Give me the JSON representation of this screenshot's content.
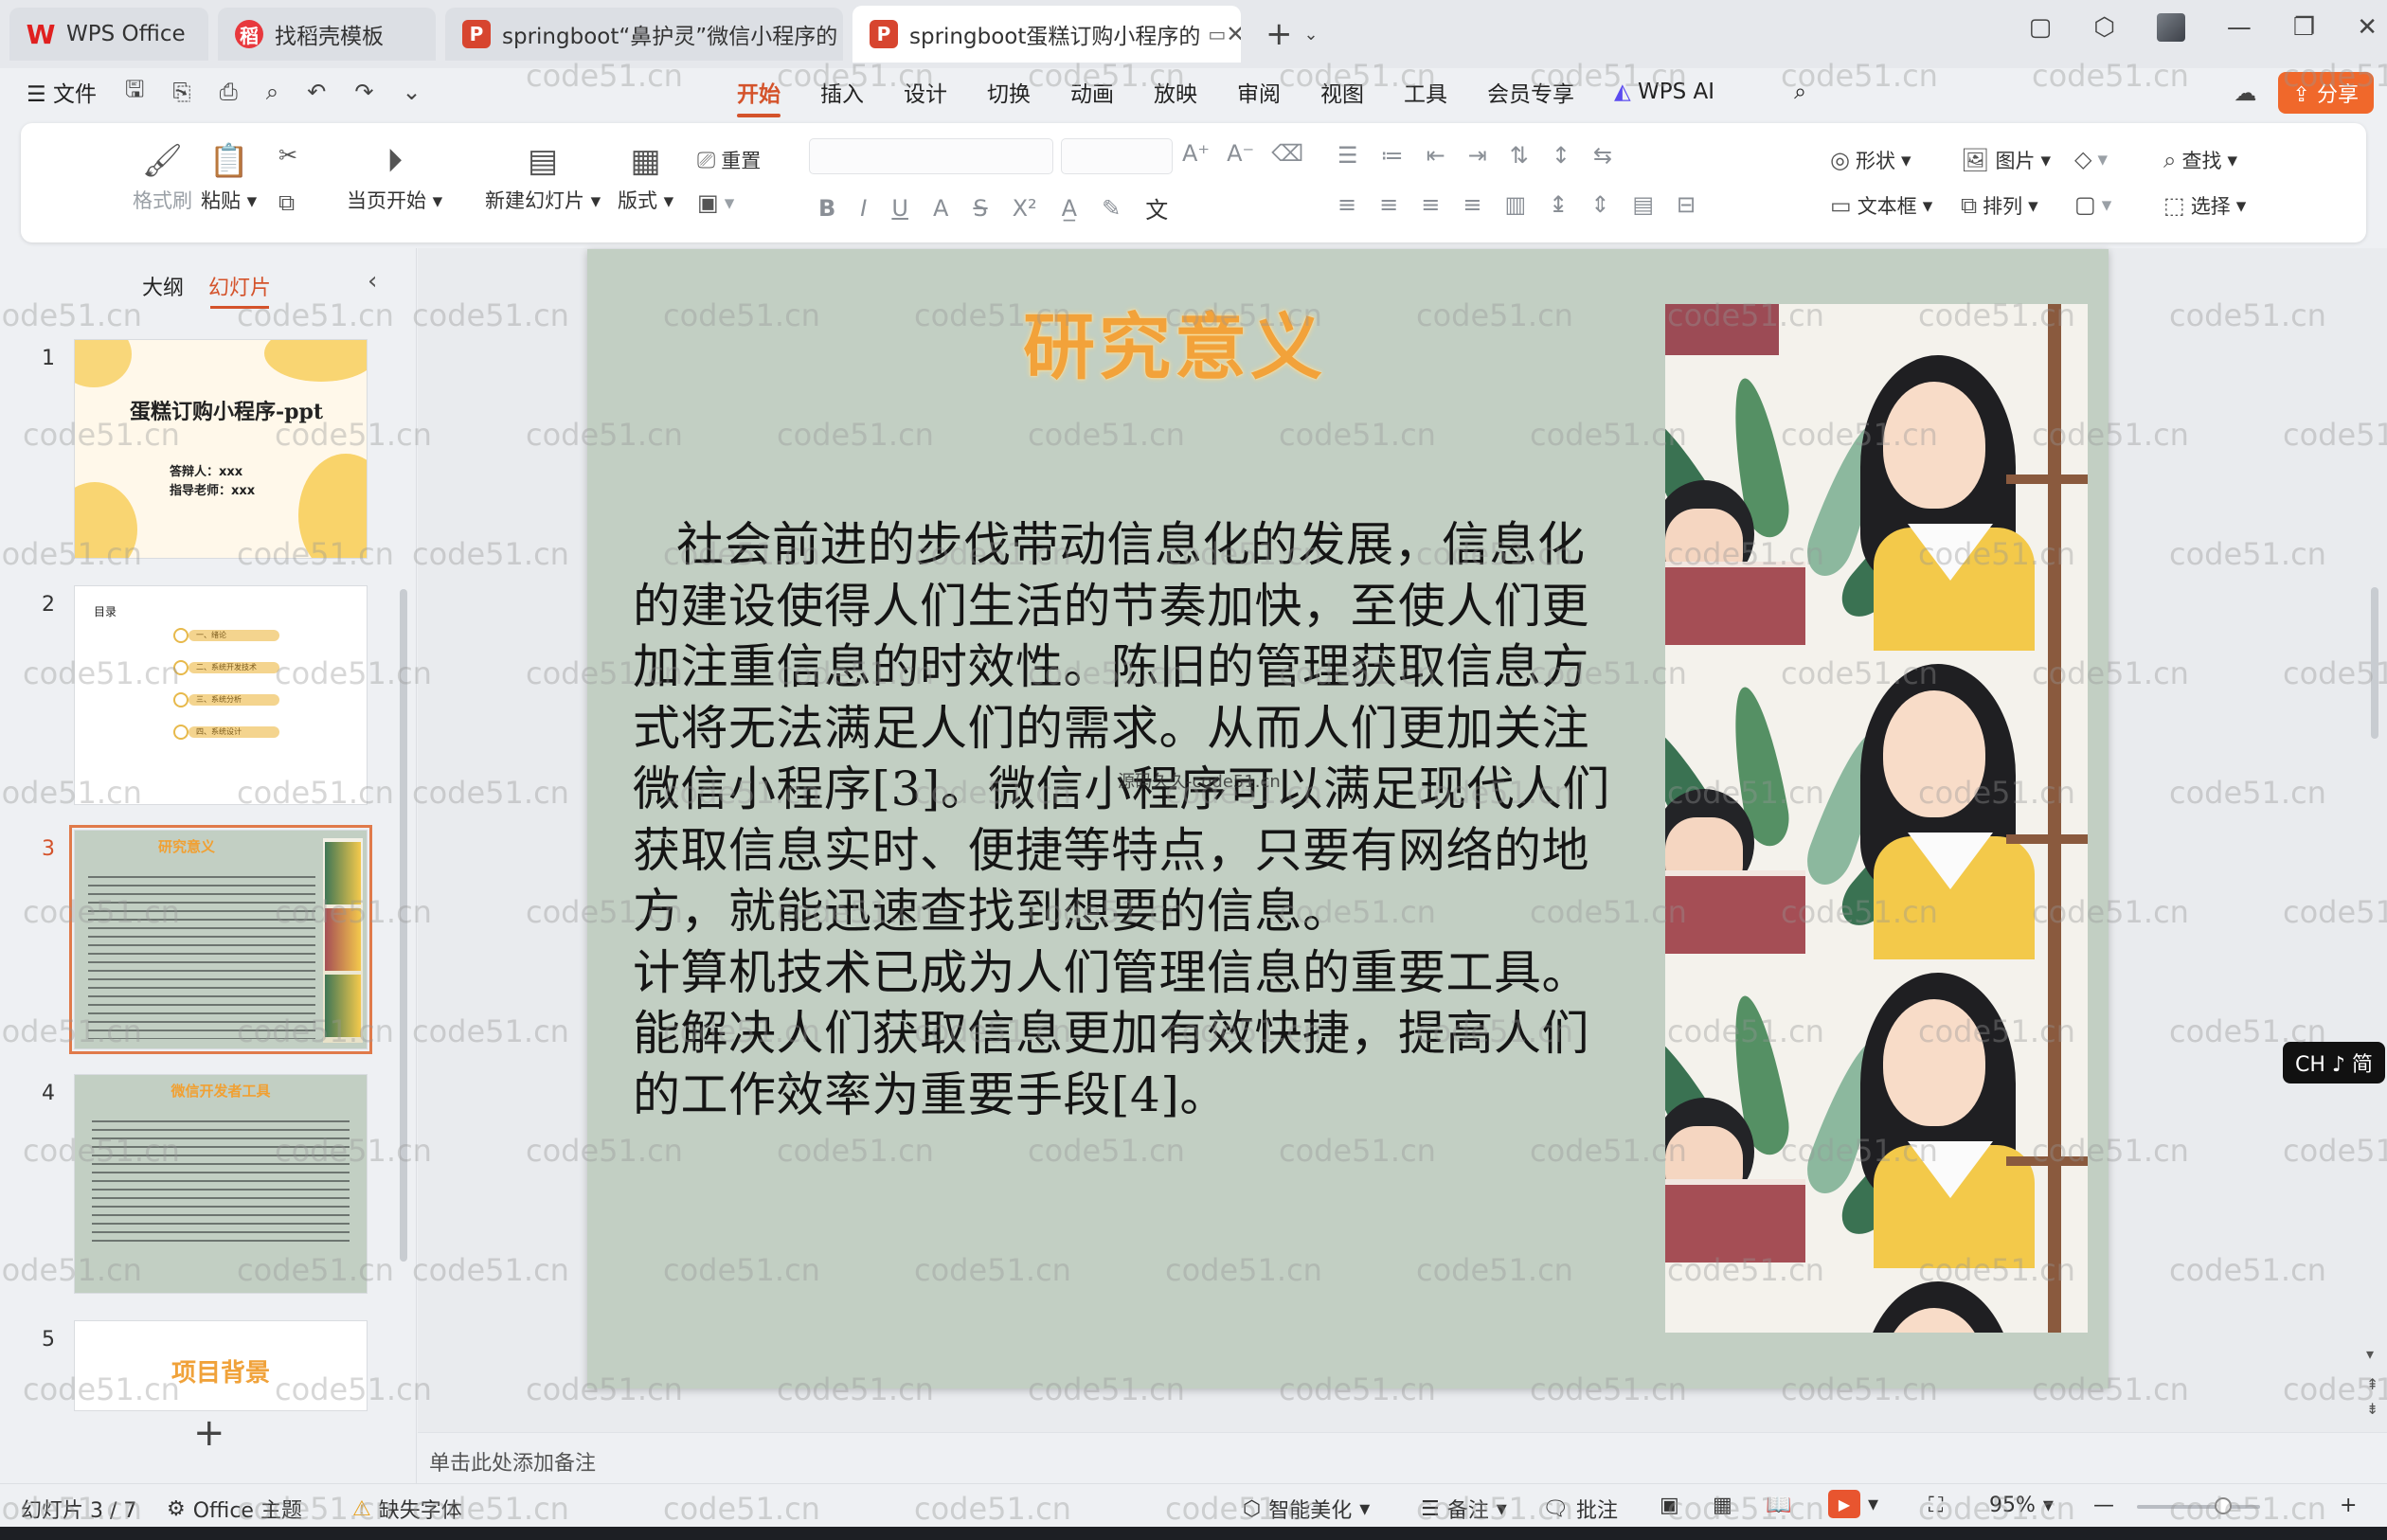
{
  "tabs": [
    {
      "label": "WPS Office"
    },
    {
      "label": "找稻壳模板"
    },
    {
      "label": "springboot“鼻护灵”微信小程序的"
    },
    {
      "label": "springboot蛋糕订购小程序的"
    }
  ],
  "menu": {
    "file": "文件",
    "items": [
      "开始",
      "插入",
      "设计",
      "切换",
      "动画",
      "放映",
      "审阅",
      "视图",
      "工具",
      "会员专享"
    ],
    "active": "开始",
    "wps_ai": "WPS AI",
    "share": "分享"
  },
  "ribbon": {
    "format_painter": "格式刷",
    "paste": "粘贴",
    "start_from_current": "当页开始",
    "new_slide": "新建幻灯片",
    "layout": "版式",
    "reset": "重置",
    "shape": "形状",
    "picture": "图片",
    "find": "查找",
    "textbox": "文本框",
    "arrange": "排列",
    "select": "选择"
  },
  "panel": {
    "outline_tab": "大纲",
    "slides_tab": "幻灯片",
    "thumbs": [
      {
        "num": "1",
        "title": "蛋糕订购小程序-ppt",
        "lines": [
          "答辩人：xxx",
          "指导老师：xxx"
        ]
      },
      {
        "num": "2",
        "title": "目录",
        "items": [
          "一、绪论",
          "二、系统开发技术",
          "三、系统分析",
          "四、系统设计"
        ]
      },
      {
        "num": "3",
        "title": "研究意义"
      },
      {
        "num": "4",
        "title": "微信开发者工具"
      },
      {
        "num": "5",
        "title": "项目背景"
      }
    ]
  },
  "slide": {
    "title": "研究意义",
    "paragraphs": [
      "社会前进的步伐带动信息化的发展，信息化的建设使得人们生活的节奏加快，至使人们更加注重信息的时效性。陈旧的管理获取信息方式将无法满足人们的需求。从而人们更加关注微信小程序[3]。微信小程序可以满足现代人们获取信息实时、便捷等特点，只要有网络的地方，就能迅速查找到想要的信息。",
      "计算机技术已成为人们管理信息的重要工具。能解决人们获取信息更加有效快捷，提高人们的工作效率为重要手段[4]。"
    ],
    "watermark_text": "源码久久-code51.cn"
  },
  "notes_placeholder": "单击此处添加备注",
  "status": {
    "slide_counter": "幻灯片 3 / 7",
    "theme": "Office 主题",
    "missing_fonts": "缺失字体",
    "beautify": "智能美化",
    "notes": "备注",
    "comments": "批注",
    "zoom": "95%"
  },
  "ime": "CH ♪ 简",
  "watermark": "code51.cn"
}
